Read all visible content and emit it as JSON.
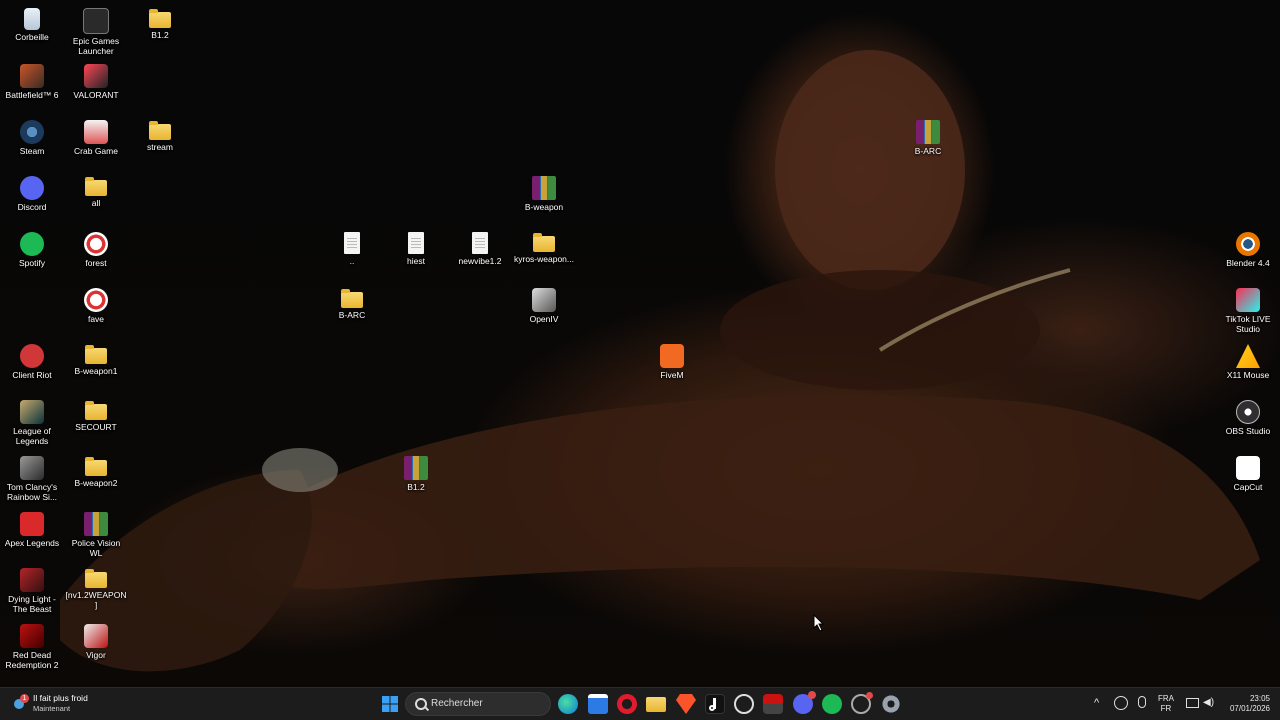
{
  "desktop": {
    "icons": [
      {
        "label": "Corbeille",
        "icon": "recycle-bin-icon"
      },
      {
        "label": "Epic Games Launcher",
        "icon": "epic-games-icon"
      },
      {
        "label": "B1.2",
        "icon": "folder-icon"
      },
      {
        "label": "Battlefield™ 6",
        "icon": "battlefield-icon"
      },
      {
        "label": "VALORANT",
        "icon": "valorant-icon"
      },
      {
        "label": "Steam",
        "icon": "steam-icon"
      },
      {
        "label": "Crab Game",
        "icon": "crab-game-icon"
      },
      {
        "label": "stream",
        "icon": "folder-icon"
      },
      {
        "label": "Discord",
        "icon": "discord-icon"
      },
      {
        "label": "all",
        "icon": "folder-icon"
      },
      {
        "label": "Spotify",
        "icon": "spotify-icon"
      },
      {
        "label": "forest",
        "icon": "shortcut-icon"
      },
      {
        "label": "fave",
        "icon": "shortcut-icon"
      },
      {
        "label": "Client Riot",
        "icon": "riot-client-icon"
      },
      {
        "label": "B-weapon1",
        "icon": "folder-icon"
      },
      {
        "label": "League of Legends",
        "icon": "league-icon"
      },
      {
        "label": "SECOURT",
        "icon": "folder-icon"
      },
      {
        "label": "Tom Clancy's Rainbow Si...",
        "icon": "rainbow-six-icon"
      },
      {
        "label": "B-weapon2",
        "icon": "folder-icon"
      },
      {
        "label": "Apex Legends",
        "icon": "apex-icon"
      },
      {
        "label": "Police Vision WL",
        "icon": "archive-icon"
      },
      {
        "label": "Dying Light - The Beast",
        "icon": "dying-light-icon"
      },
      {
        "label": "[nv1.2WEAPON]",
        "icon": "folder-icon"
      },
      {
        "label": "Red Dead Redemption 2",
        "icon": "rdr2-icon"
      },
      {
        "label": "Vigor",
        "icon": "vigor-icon"
      },
      {
        "label": "B-weapon",
        "icon": "archive-icon"
      },
      {
        "label": "..",
        "icon": "document-icon"
      },
      {
        "label": "hiest",
        "icon": "document-icon"
      },
      {
        "label": "newvibe1.2",
        "icon": "document-icon"
      },
      {
        "label": "kyros-weapon...",
        "icon": "folder-icon"
      },
      {
        "label": "B-ARC",
        "icon": "folder-icon"
      },
      {
        "label": "OpenIV",
        "icon": "openiv-icon"
      },
      {
        "label": "FiveM",
        "icon": "fivem-icon"
      },
      {
        "label": "B1.2",
        "icon": "archive-icon"
      },
      {
        "label": "B-ARC",
        "icon": "archive-icon"
      },
      {
        "label": "Blender 4.4",
        "icon": "blender-icon"
      },
      {
        "label": "TikTok LIVE Studio",
        "icon": "tiktok-live-icon"
      },
      {
        "label": "X11 Mouse",
        "icon": "x11-mouse-icon"
      },
      {
        "label": "OBS Studio",
        "icon": "obs-icon"
      },
      {
        "label": "CapCut",
        "icon": "capcut-icon"
      }
    ]
  },
  "taskbar": {
    "weather": {
      "title": "Il fait plus froid",
      "subtitle": "Maintenant",
      "icon": "weather-icon",
      "badge": "1"
    },
    "search_placeholder": "Rechercher",
    "apps": [
      {
        "name": "start-button",
        "icon": "windows-logo-icon"
      },
      {
        "name": "edge",
        "icon": "edge-icon"
      },
      {
        "name": "store",
        "icon": "store-icon"
      },
      {
        "name": "opera",
        "icon": "opera-icon"
      },
      {
        "name": "file-explorer",
        "icon": "folder-icon"
      },
      {
        "name": "brave",
        "icon": "brave-icon"
      },
      {
        "name": "tiktok",
        "icon": "tiktok-icon"
      },
      {
        "name": "app-q",
        "icon": "circle-q-icon"
      },
      {
        "name": "voicemeeter",
        "icon": "voicemeeter-icon"
      },
      {
        "name": "discord",
        "icon": "discord-icon"
      },
      {
        "name": "spotify",
        "icon": "spotify-icon"
      },
      {
        "name": "app-arc",
        "icon": "arc-icon"
      },
      {
        "name": "settings",
        "icon": "gear-icon"
      }
    ],
    "tray": {
      "language_line1": "FRA",
      "language_line2": "FR",
      "time": "23:05",
      "date": "07/01/2026"
    }
  },
  "colors": {
    "taskbar_bg": "#1c1c1c",
    "folder": "#e8b531",
    "accent": "#0078d4"
  }
}
